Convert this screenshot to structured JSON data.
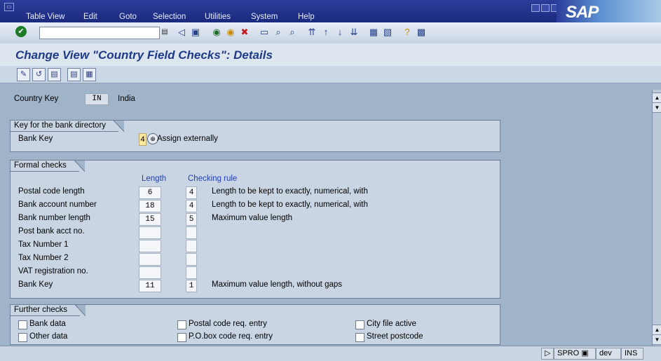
{
  "menu": {
    "items": [
      "Table View",
      "Edit",
      "Goto",
      "Selection",
      "Utilities",
      "System",
      "Help"
    ]
  },
  "brand": "SAP",
  "title": "Change View \"Country Field Checks\": Details",
  "country": {
    "label": "Country Key",
    "key": "IN",
    "name": "India"
  },
  "bank_directory": {
    "frame_title": "Key for the bank directory",
    "label": "Bank Key",
    "value": "4",
    "description": "Assign externally"
  },
  "formal_checks": {
    "frame_title": "Formal checks",
    "col_length": "Length",
    "col_rule": "Checking rule",
    "rows": [
      {
        "label": "Postal code length",
        "length": "6",
        "rule": "4",
        "desc": "Length to be kept to exactly, numerical, with"
      },
      {
        "label": "Bank account number",
        "length": "18",
        "rule": "4",
        "desc": "Length to be kept to exactly, numerical, with"
      },
      {
        "label": "Bank number length",
        "length": "15",
        "rule": "5",
        "desc": "Maximum value length"
      },
      {
        "label": "Post bank acct no.",
        "length": "",
        "rule": "",
        "desc": ""
      },
      {
        "label": "Tax Number 1",
        "length": "",
        "rule": "",
        "desc": ""
      },
      {
        "label": "Tax Number 2",
        "length": "",
        "rule": "",
        "desc": ""
      },
      {
        "label": "VAT registration no.",
        "length": "",
        "rule": "",
        "desc": ""
      },
      {
        "label": "Bank Key",
        "length": "11",
        "rule": "1",
        "desc": "Maximum value length, without gaps"
      }
    ]
  },
  "further_checks": {
    "frame_title": "Further checks",
    "items": [
      {
        "label": "Bank data",
        "checked": false
      },
      {
        "label": "Postal code req. entry",
        "checked": false
      },
      {
        "label": "City file active",
        "checked": false
      },
      {
        "label": "Other data",
        "checked": false
      },
      {
        "label": "P.O.box code req. entry",
        "checked": false
      },
      {
        "label": "Street postcode",
        "checked": false
      }
    ]
  },
  "status": {
    "transaction": "SPRO",
    "client": "dev",
    "mode": "INS"
  }
}
